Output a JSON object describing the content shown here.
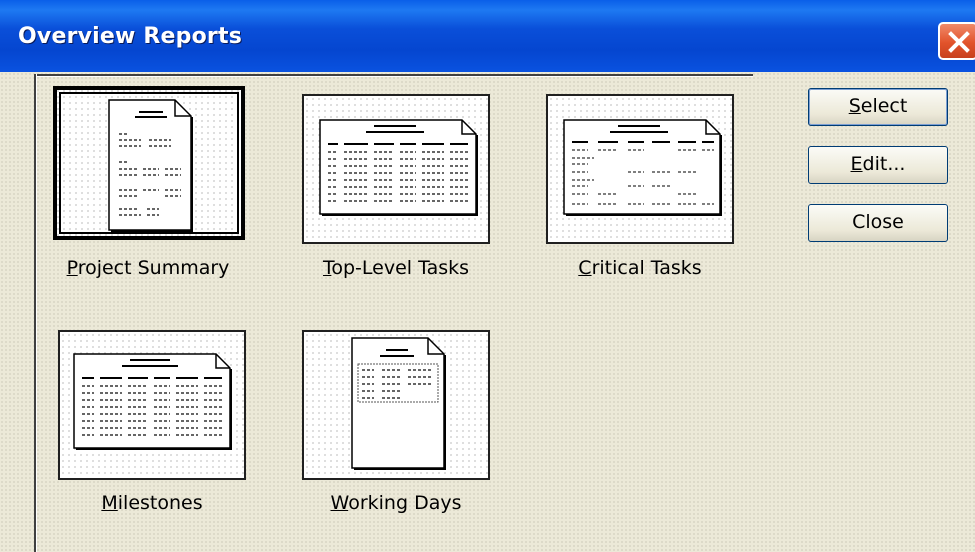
{
  "window": {
    "title": "Overview Reports"
  },
  "reports": [
    {
      "id": "project-summary",
      "label": "Project Summary",
      "mnemonic": "P",
      "rest": "roject Summary",
      "selected": true
    },
    {
      "id": "top-level-tasks",
      "label": "Top-Level Tasks",
      "mnemonic": "T",
      "rest": "op-Level Tasks",
      "selected": false
    },
    {
      "id": "critical-tasks",
      "label": "Critical Tasks",
      "mnemonic": "C",
      "rest": "ritical Tasks",
      "selected": false
    },
    {
      "id": "milestones",
      "label": "Milestones",
      "mnemonic": "M",
      "rest": "ilestones",
      "selected": false
    },
    {
      "id": "working-days",
      "label": "Working Days",
      "mnemonic": "W",
      "rest": "orking Days",
      "selected": false
    }
  ],
  "buttons": {
    "select": {
      "label": "Select",
      "mnemonic": "S",
      "rest": "elect"
    },
    "edit": {
      "label": "Edit...",
      "mnemonic": "E",
      "rest": "dit..."
    },
    "close": {
      "label": "Close"
    }
  },
  "icons": {
    "close": "close-icon",
    "page": "report-page-icon"
  }
}
